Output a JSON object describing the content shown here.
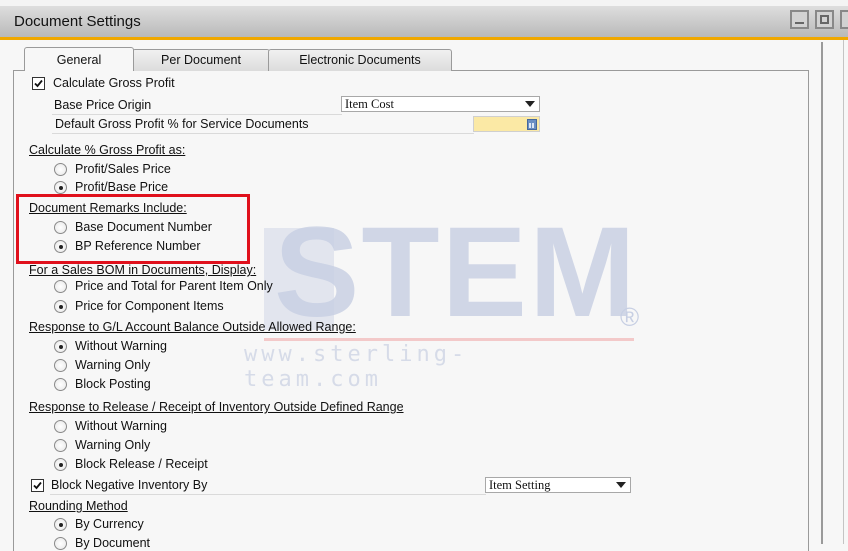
{
  "window": {
    "title": "Document Settings",
    "controls": {
      "minimize": "minimize-icon",
      "maximize": "maximize-icon"
    }
  },
  "tabs": [
    {
      "label": "General",
      "active": true
    },
    {
      "label": "Per Document",
      "active": false
    },
    {
      "label": "Electronic Documents",
      "active": false
    }
  ],
  "general": {
    "calculate_gross_profit": {
      "label": "Calculate Gross Profit",
      "checked": true
    },
    "base_price_origin": {
      "label": "Base Price Origin",
      "value": "Item Cost"
    },
    "default_gp_percent": {
      "label": "Default Gross Profit % for Service Documents",
      "value": ""
    },
    "calc_gp_as": {
      "header": "Calculate % Gross Profit as:",
      "options": [
        {
          "label": "Profit/Sales Price",
          "selected": false
        },
        {
          "label": "Profit/Base Price",
          "selected": true
        }
      ]
    },
    "doc_remarks": {
      "header": "Document Remarks Include:",
      "options": [
        {
          "label": "Base Document Number",
          "selected": false
        },
        {
          "label": "BP Reference Number",
          "selected": true
        }
      ]
    },
    "sales_bom": {
      "header": "For a Sales BOM in Documents, Display:",
      "options": [
        {
          "label": "Price and Total for Parent Item Only",
          "selected": false
        },
        {
          "label": "Price for Component Items",
          "selected": true
        }
      ]
    },
    "gl_response": {
      "header": "Response to G/L Account Balance Outside Allowed Range:",
      "options": [
        {
          "label": "Without Warning",
          "selected": true
        },
        {
          "label": "Warning Only",
          "selected": false
        },
        {
          "label": "Block Posting",
          "selected": false
        }
      ]
    },
    "inventory_response": {
      "header": "Response to Release / Receipt of Inventory Outside Defined Range",
      "options": [
        {
          "label": "Without Warning",
          "selected": false
        },
        {
          "label": "Warning Only",
          "selected": false
        },
        {
          "label": "Block Release / Receipt",
          "selected": true
        }
      ]
    },
    "block_negative": {
      "label": "Block Negative Inventory By",
      "checked": true,
      "value": "Item Setting"
    },
    "rounding": {
      "header": "Rounding Method",
      "options": [
        {
          "label": "By Currency",
          "selected": true
        },
        {
          "label": "By Document",
          "selected": false
        }
      ]
    }
  },
  "watermark": {
    "brand": "STEM",
    "registered": "®",
    "url": "www.sterling-team.com"
  },
  "colors": {
    "accent_orange": "#f0a800",
    "highlight_red": "#e0101c",
    "numeric_field": "#fbe9a5"
  }
}
